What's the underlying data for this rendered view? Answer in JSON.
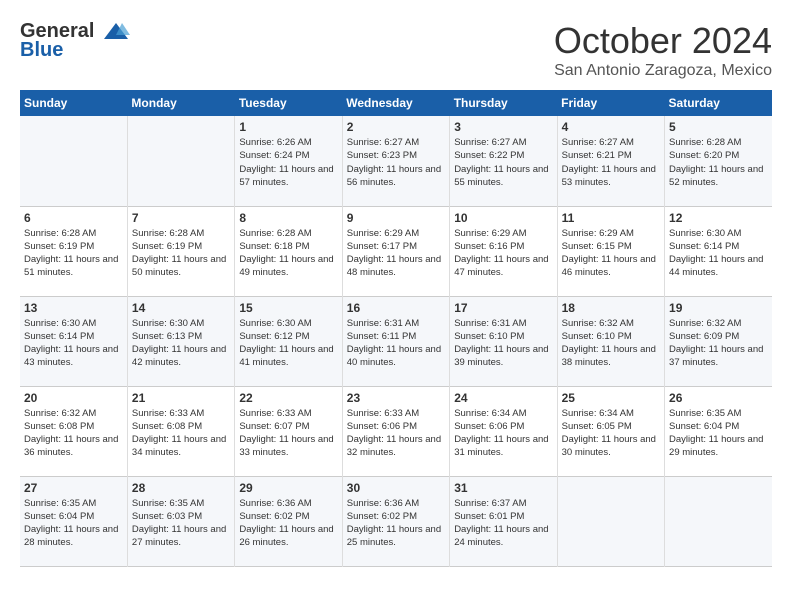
{
  "header": {
    "logo_line1": "General",
    "logo_line2": "Blue",
    "month": "October 2024",
    "location": "San Antonio Zaragoza, Mexico"
  },
  "days_of_week": [
    "Sunday",
    "Monday",
    "Tuesday",
    "Wednesday",
    "Thursday",
    "Friday",
    "Saturday"
  ],
  "weeks": [
    [
      {
        "day": "",
        "sunrise": "",
        "sunset": "",
        "daylight": ""
      },
      {
        "day": "",
        "sunrise": "",
        "sunset": "",
        "daylight": ""
      },
      {
        "day": "1",
        "sunrise": "Sunrise: 6:26 AM",
        "sunset": "Sunset: 6:24 PM",
        "daylight": "Daylight: 11 hours and 57 minutes."
      },
      {
        "day": "2",
        "sunrise": "Sunrise: 6:27 AM",
        "sunset": "Sunset: 6:23 PM",
        "daylight": "Daylight: 11 hours and 56 minutes."
      },
      {
        "day": "3",
        "sunrise": "Sunrise: 6:27 AM",
        "sunset": "Sunset: 6:22 PM",
        "daylight": "Daylight: 11 hours and 55 minutes."
      },
      {
        "day": "4",
        "sunrise": "Sunrise: 6:27 AM",
        "sunset": "Sunset: 6:21 PM",
        "daylight": "Daylight: 11 hours and 53 minutes."
      },
      {
        "day": "5",
        "sunrise": "Sunrise: 6:28 AM",
        "sunset": "Sunset: 6:20 PM",
        "daylight": "Daylight: 11 hours and 52 minutes."
      }
    ],
    [
      {
        "day": "6",
        "sunrise": "Sunrise: 6:28 AM",
        "sunset": "Sunset: 6:19 PM",
        "daylight": "Daylight: 11 hours and 51 minutes."
      },
      {
        "day": "7",
        "sunrise": "Sunrise: 6:28 AM",
        "sunset": "Sunset: 6:19 PM",
        "daylight": "Daylight: 11 hours and 50 minutes."
      },
      {
        "day": "8",
        "sunrise": "Sunrise: 6:28 AM",
        "sunset": "Sunset: 6:18 PM",
        "daylight": "Daylight: 11 hours and 49 minutes."
      },
      {
        "day": "9",
        "sunrise": "Sunrise: 6:29 AM",
        "sunset": "Sunset: 6:17 PM",
        "daylight": "Daylight: 11 hours and 48 minutes."
      },
      {
        "day": "10",
        "sunrise": "Sunrise: 6:29 AM",
        "sunset": "Sunset: 6:16 PM",
        "daylight": "Daylight: 11 hours and 47 minutes."
      },
      {
        "day": "11",
        "sunrise": "Sunrise: 6:29 AM",
        "sunset": "Sunset: 6:15 PM",
        "daylight": "Daylight: 11 hours and 46 minutes."
      },
      {
        "day": "12",
        "sunrise": "Sunrise: 6:30 AM",
        "sunset": "Sunset: 6:14 PM",
        "daylight": "Daylight: 11 hours and 44 minutes."
      }
    ],
    [
      {
        "day": "13",
        "sunrise": "Sunrise: 6:30 AM",
        "sunset": "Sunset: 6:14 PM",
        "daylight": "Daylight: 11 hours and 43 minutes."
      },
      {
        "day": "14",
        "sunrise": "Sunrise: 6:30 AM",
        "sunset": "Sunset: 6:13 PM",
        "daylight": "Daylight: 11 hours and 42 minutes."
      },
      {
        "day": "15",
        "sunrise": "Sunrise: 6:30 AM",
        "sunset": "Sunset: 6:12 PM",
        "daylight": "Daylight: 11 hours and 41 minutes."
      },
      {
        "day": "16",
        "sunrise": "Sunrise: 6:31 AM",
        "sunset": "Sunset: 6:11 PM",
        "daylight": "Daylight: 11 hours and 40 minutes."
      },
      {
        "day": "17",
        "sunrise": "Sunrise: 6:31 AM",
        "sunset": "Sunset: 6:10 PM",
        "daylight": "Daylight: 11 hours and 39 minutes."
      },
      {
        "day": "18",
        "sunrise": "Sunrise: 6:32 AM",
        "sunset": "Sunset: 6:10 PM",
        "daylight": "Daylight: 11 hours and 38 minutes."
      },
      {
        "day": "19",
        "sunrise": "Sunrise: 6:32 AM",
        "sunset": "Sunset: 6:09 PM",
        "daylight": "Daylight: 11 hours and 37 minutes."
      }
    ],
    [
      {
        "day": "20",
        "sunrise": "Sunrise: 6:32 AM",
        "sunset": "Sunset: 6:08 PM",
        "daylight": "Daylight: 11 hours and 36 minutes."
      },
      {
        "day": "21",
        "sunrise": "Sunrise: 6:33 AM",
        "sunset": "Sunset: 6:08 PM",
        "daylight": "Daylight: 11 hours and 34 minutes."
      },
      {
        "day": "22",
        "sunrise": "Sunrise: 6:33 AM",
        "sunset": "Sunset: 6:07 PM",
        "daylight": "Daylight: 11 hours and 33 minutes."
      },
      {
        "day": "23",
        "sunrise": "Sunrise: 6:33 AM",
        "sunset": "Sunset: 6:06 PM",
        "daylight": "Daylight: 11 hours and 32 minutes."
      },
      {
        "day": "24",
        "sunrise": "Sunrise: 6:34 AM",
        "sunset": "Sunset: 6:06 PM",
        "daylight": "Daylight: 11 hours and 31 minutes."
      },
      {
        "day": "25",
        "sunrise": "Sunrise: 6:34 AM",
        "sunset": "Sunset: 6:05 PM",
        "daylight": "Daylight: 11 hours and 30 minutes."
      },
      {
        "day": "26",
        "sunrise": "Sunrise: 6:35 AM",
        "sunset": "Sunset: 6:04 PM",
        "daylight": "Daylight: 11 hours and 29 minutes."
      }
    ],
    [
      {
        "day": "27",
        "sunrise": "Sunrise: 6:35 AM",
        "sunset": "Sunset: 6:04 PM",
        "daylight": "Daylight: 11 hours and 28 minutes."
      },
      {
        "day": "28",
        "sunrise": "Sunrise: 6:35 AM",
        "sunset": "Sunset: 6:03 PM",
        "daylight": "Daylight: 11 hours and 27 minutes."
      },
      {
        "day": "29",
        "sunrise": "Sunrise: 6:36 AM",
        "sunset": "Sunset: 6:02 PM",
        "daylight": "Daylight: 11 hours and 26 minutes."
      },
      {
        "day": "30",
        "sunrise": "Sunrise: 6:36 AM",
        "sunset": "Sunset: 6:02 PM",
        "daylight": "Daylight: 11 hours and 25 minutes."
      },
      {
        "day": "31",
        "sunrise": "Sunrise: 6:37 AM",
        "sunset": "Sunset: 6:01 PM",
        "daylight": "Daylight: 11 hours and 24 minutes."
      },
      {
        "day": "",
        "sunrise": "",
        "sunset": "",
        "daylight": ""
      },
      {
        "day": "",
        "sunrise": "",
        "sunset": "",
        "daylight": ""
      }
    ]
  ]
}
